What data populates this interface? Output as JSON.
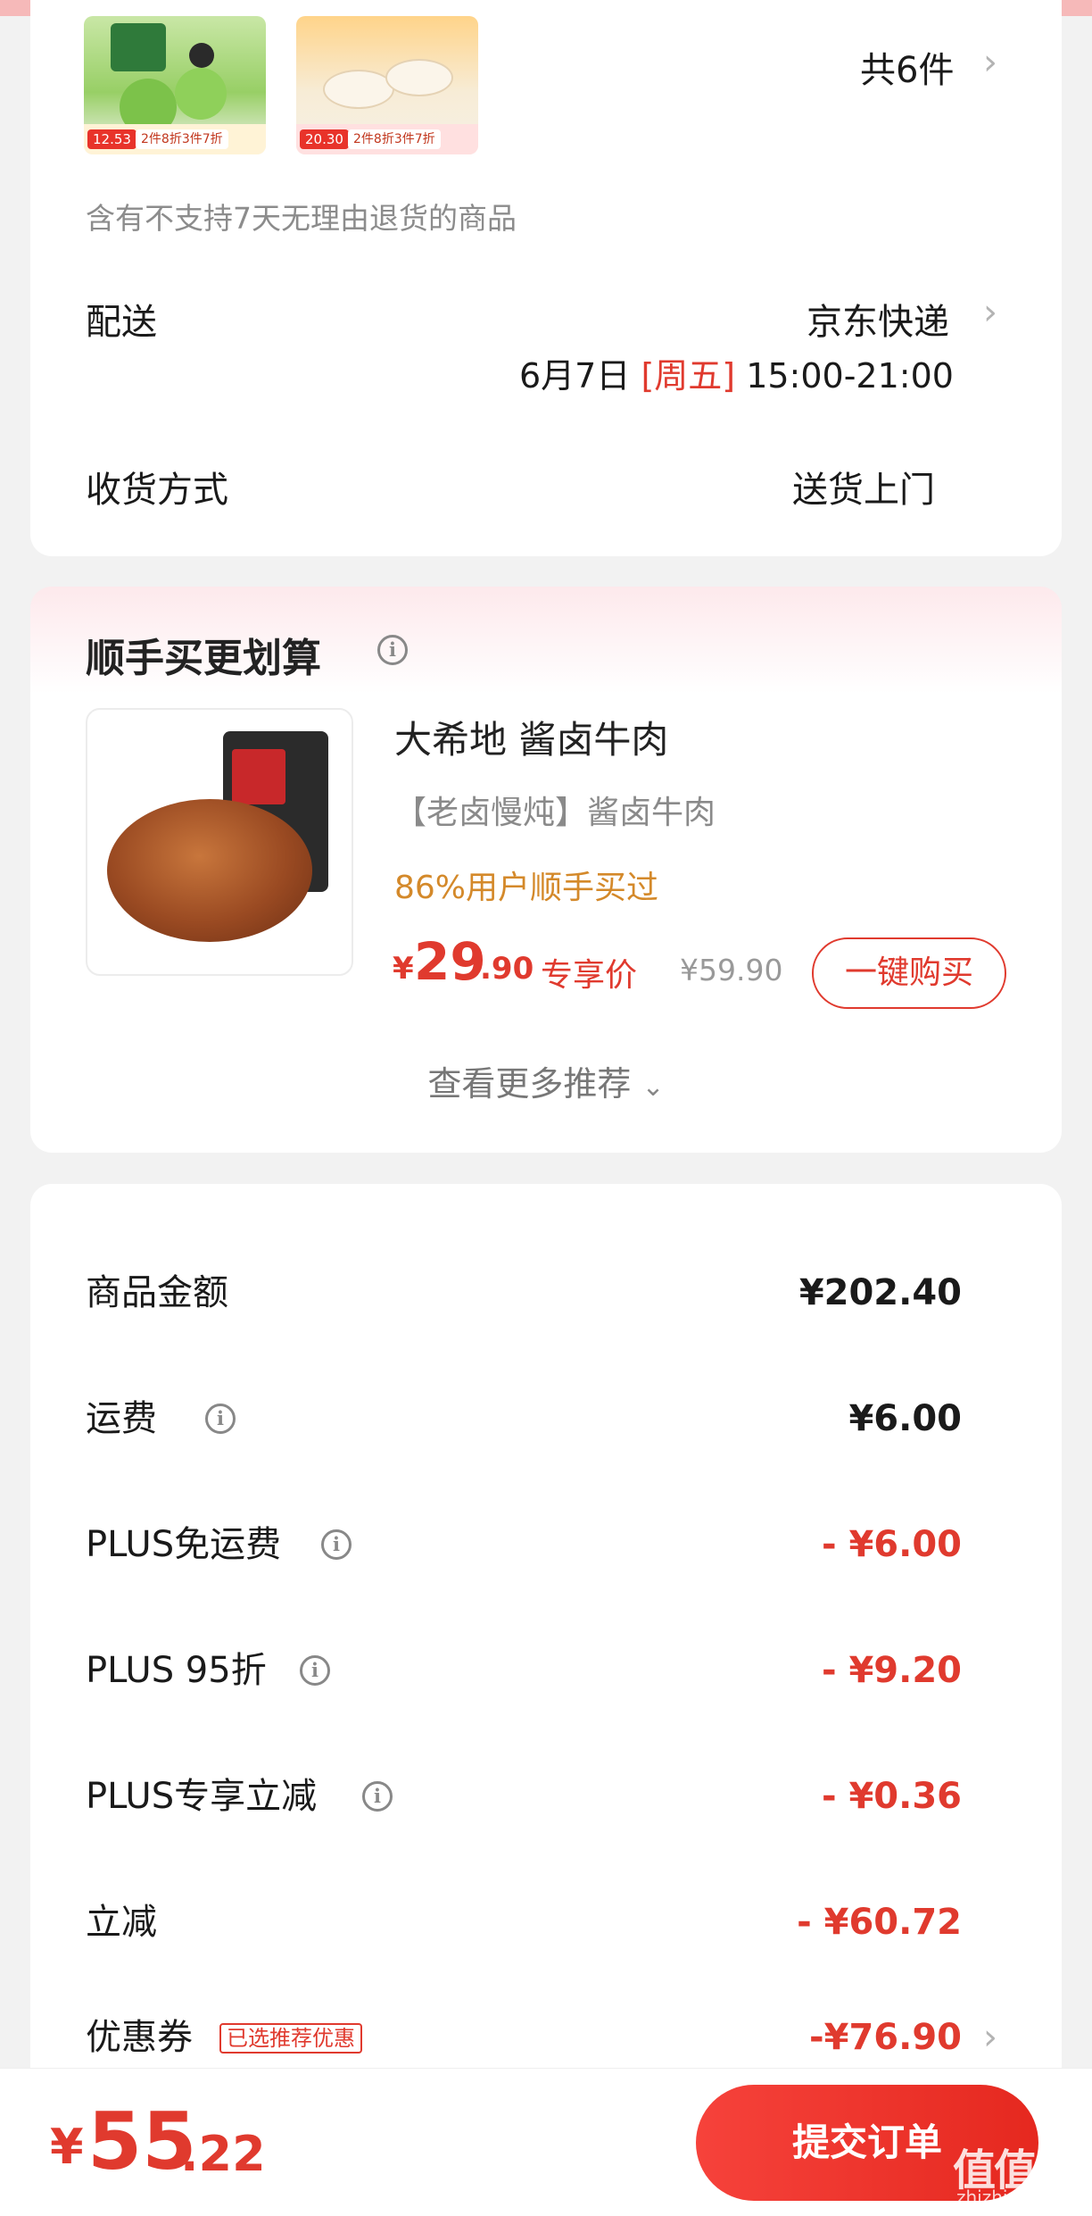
{
  "order": {
    "count_label": "共6件",
    "return_note": "含有不支持7天无理由退货的商品",
    "thumb1_promo": "2件8折3件7折",
    "thumb2_promo": "2件8折3件7折",
    "thumb1_price": "12.53",
    "thumb2_price": "20.30",
    "delivery_label": "配送",
    "delivery_value": "京东快递",
    "delivery_date": "6月7日",
    "delivery_weekday": "[周五]",
    "delivery_time": "15:00-21:00",
    "receive_label": "收货方式",
    "receive_value": "送货上门"
  },
  "recommend": {
    "title": "顺手买更划算",
    "product_name": "大希地 酱卤牛肉",
    "product_sub": "【老卤慢炖】酱卤牛肉",
    "buy_rate": "86%用户顺手买过",
    "price_currency": "¥",
    "price_int": "29",
    "price_dec": ".90",
    "exclusive_label": "专享价",
    "original_price": "¥59.90",
    "buy_button": "一键购买",
    "more_label": "查看更多推荐"
  },
  "summary": {
    "rows": [
      {
        "label": "商品金额",
        "value": "¥202.40"
      },
      {
        "label": "运费",
        "value": "¥6.00"
      },
      {
        "label": "PLUS免运费",
        "value": "- ¥6.00"
      },
      {
        "label": "PLUS 95折",
        "value": "- ¥9.20"
      },
      {
        "label": "PLUS专享立减",
        "value": "- ¥0.36"
      },
      {
        "label": "立减",
        "value": "- ¥60.72"
      },
      {
        "label": "优惠券",
        "value": "-¥76.90"
      }
    ],
    "coupon_tag": "已选推荐优惠"
  },
  "footer": {
    "total_currency": "¥",
    "total_int": "55",
    "total_dec": ".22",
    "submit_label": "提交订单",
    "watermark": "值值值",
    "watermark_sub": "zhizhizhi.com"
  },
  "colors": {
    "accent_red": "#e03a2e",
    "promo_gold": "#d4892a",
    "background": "#f2f2f2"
  },
  "icons": [
    "chevron-right-icon",
    "info-icon",
    "chevron-down-icon"
  ]
}
